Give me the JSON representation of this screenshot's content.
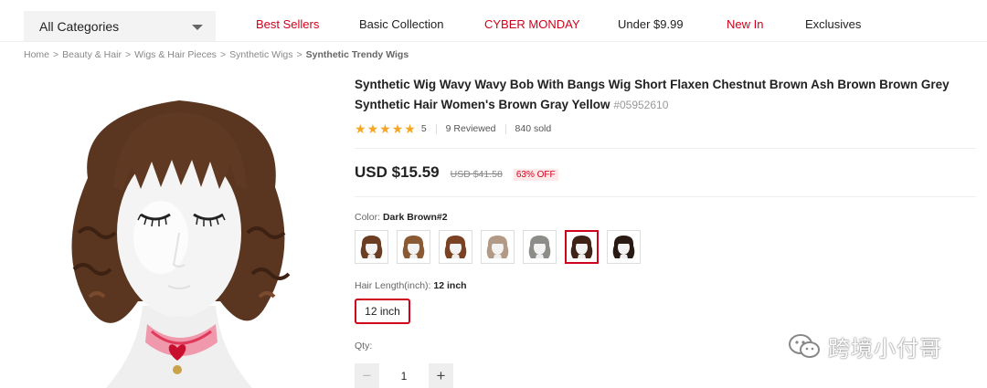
{
  "nav": {
    "category_select": "All Categories",
    "links": [
      "Best Sellers",
      "Basic Collection",
      "CYBER MONDAY",
      "Under $9.99",
      "New In",
      "Exclusives"
    ]
  },
  "breadcrumb": [
    "Home",
    "Beauty & Hair",
    "Wigs & Hair Pieces",
    "Synthetic Wigs",
    "Synthetic Trendy Wigs"
  ],
  "product": {
    "title": "Synthetic Wig Wavy Wavy Bob With Bangs Wig Short Flaxen Chestnut Brown Ash Brown Brown Grey Synthetic Hair Women's Brown Gray Yellow",
    "sku": "#05952610",
    "rating_value": "5",
    "reviews": "9 Reviewed",
    "sold": "840 sold",
    "price": "USD $15.59",
    "original_price": "USD $41.58",
    "discount": "63% OFF",
    "color_label": "Color:",
    "color_selected": "Dark Brown#2",
    "length_label": "Hair Length(inch):",
    "length_selected": "12 inch",
    "length_option": "12 inch",
    "qty_label": "Qty:",
    "qty_value": "1"
  },
  "swatches": [
    {
      "name": "brown",
      "hair": "#6b3d22",
      "selected": false
    },
    {
      "name": "light-brown",
      "hair": "#8a5a34",
      "selected": false
    },
    {
      "name": "chestnut",
      "hair": "#7a4222",
      "selected": false
    },
    {
      "name": "ash-brown",
      "hair": "#b39a86",
      "selected": false
    },
    {
      "name": "grey",
      "hair": "#8c8c88",
      "selected": false
    },
    {
      "name": "dark-brown-2",
      "hair": "#3e2316",
      "selected": true
    },
    {
      "name": "black-brown",
      "hair": "#2a1a14",
      "selected": false
    }
  ],
  "watermark": "跨境小付哥",
  "colors": {
    "accent": "#d0021b",
    "star": "#f5a623"
  }
}
